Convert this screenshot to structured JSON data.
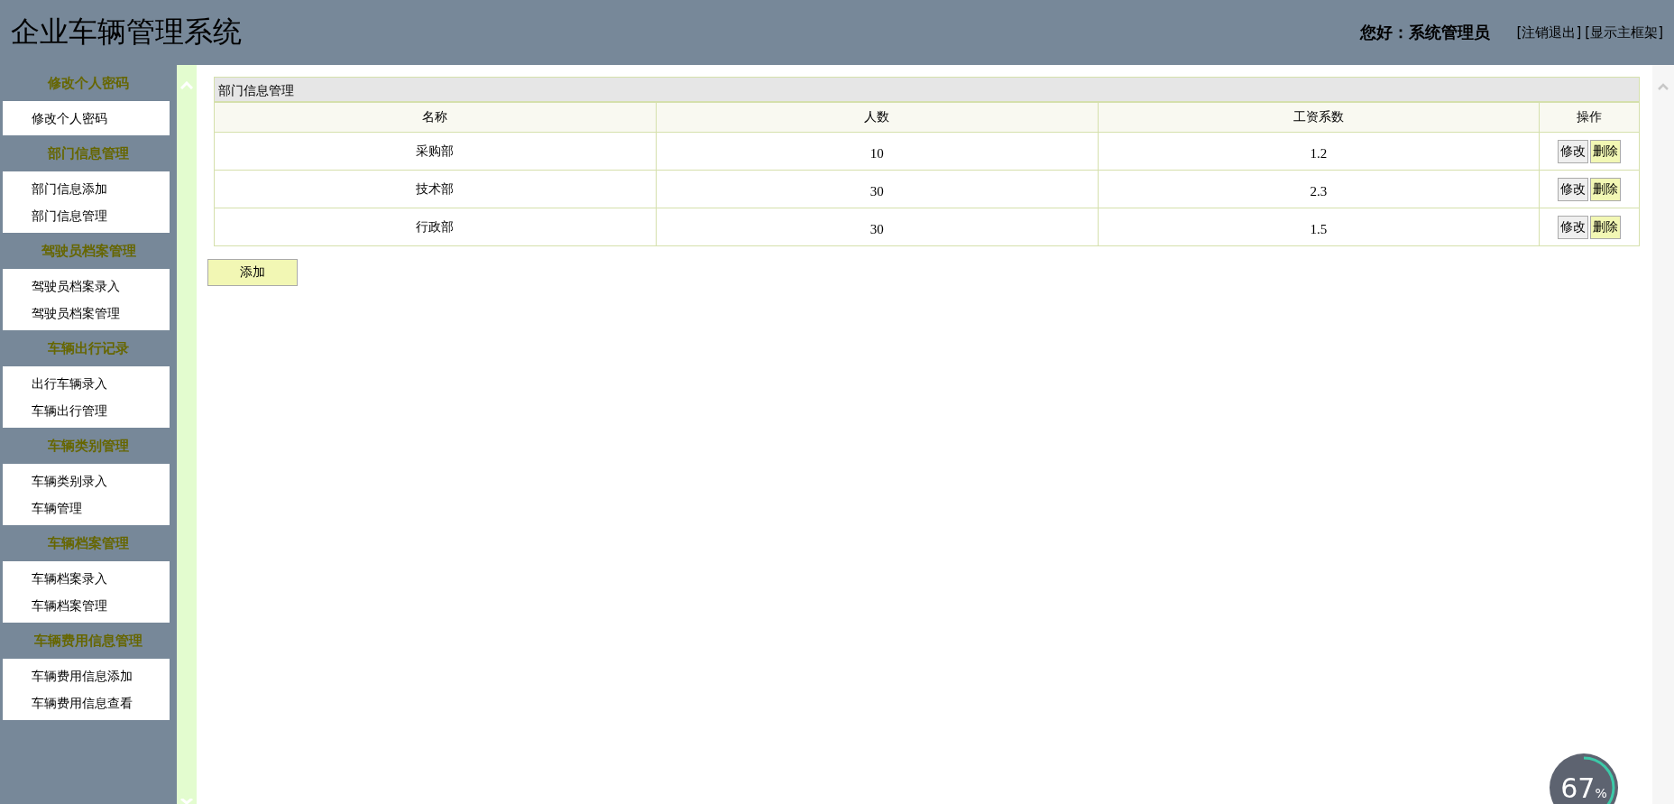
{
  "header": {
    "title": "企业车辆管理系统",
    "greeting": "您好：系统管理员",
    "links": [
      "[注销退出]",
      "[显示主框架]"
    ]
  },
  "sidebar": {
    "groups": [
      {
        "title": "修改个人密码",
        "items": [
          "修改个人密码"
        ]
      },
      {
        "title": "部门信息管理",
        "items": [
          "部门信息添加",
          "部门信息管理"
        ]
      },
      {
        "title": "驾驶员档案管理",
        "items": [
          "驾驶员档案录入",
          "驾驶员档案管理"
        ]
      },
      {
        "title": "车辆出行记录",
        "items": [
          "出行车辆录入",
          "车辆出行管理"
        ]
      },
      {
        "title": "车辆类别管理",
        "items": [
          "车辆类别录入",
          "车辆管理"
        ]
      },
      {
        "title": "车辆档案管理",
        "items": [
          "车辆档案录入",
          "车辆档案管理"
        ]
      },
      {
        "title": "车辆费用信息管理",
        "items": [
          "车辆费用信息添加",
          "车辆费用信息查看"
        ]
      }
    ]
  },
  "panel": {
    "title": "部门信息管理",
    "table": {
      "columns": [
        "名称",
        "人数",
        "工资系数",
        "操作"
      ],
      "rows": [
        {
          "cells": [
            "采购部",
            "10",
            "1.2"
          ],
          "actions": [
            {
              "kind": "edit",
              "label": "修改"
            },
            {
              "kind": "delete",
              "label": "删除"
            }
          ]
        },
        {
          "cells": [
            "技术部",
            "30",
            "2.3"
          ],
          "actions": [
            {
              "kind": "edit",
              "label": "修改"
            },
            {
              "kind": "delete",
              "label": "删除"
            }
          ]
        },
        {
          "cells": [
            "行政部",
            "30",
            "1.5"
          ],
          "actions": [
            {
              "kind": "edit",
              "label": "修改"
            },
            {
              "kind": "delete",
              "label": "删除"
            }
          ]
        }
      ]
    },
    "add_button": "添加"
  },
  "speed_widget": {
    "value": "67",
    "unit": "%"
  }
}
